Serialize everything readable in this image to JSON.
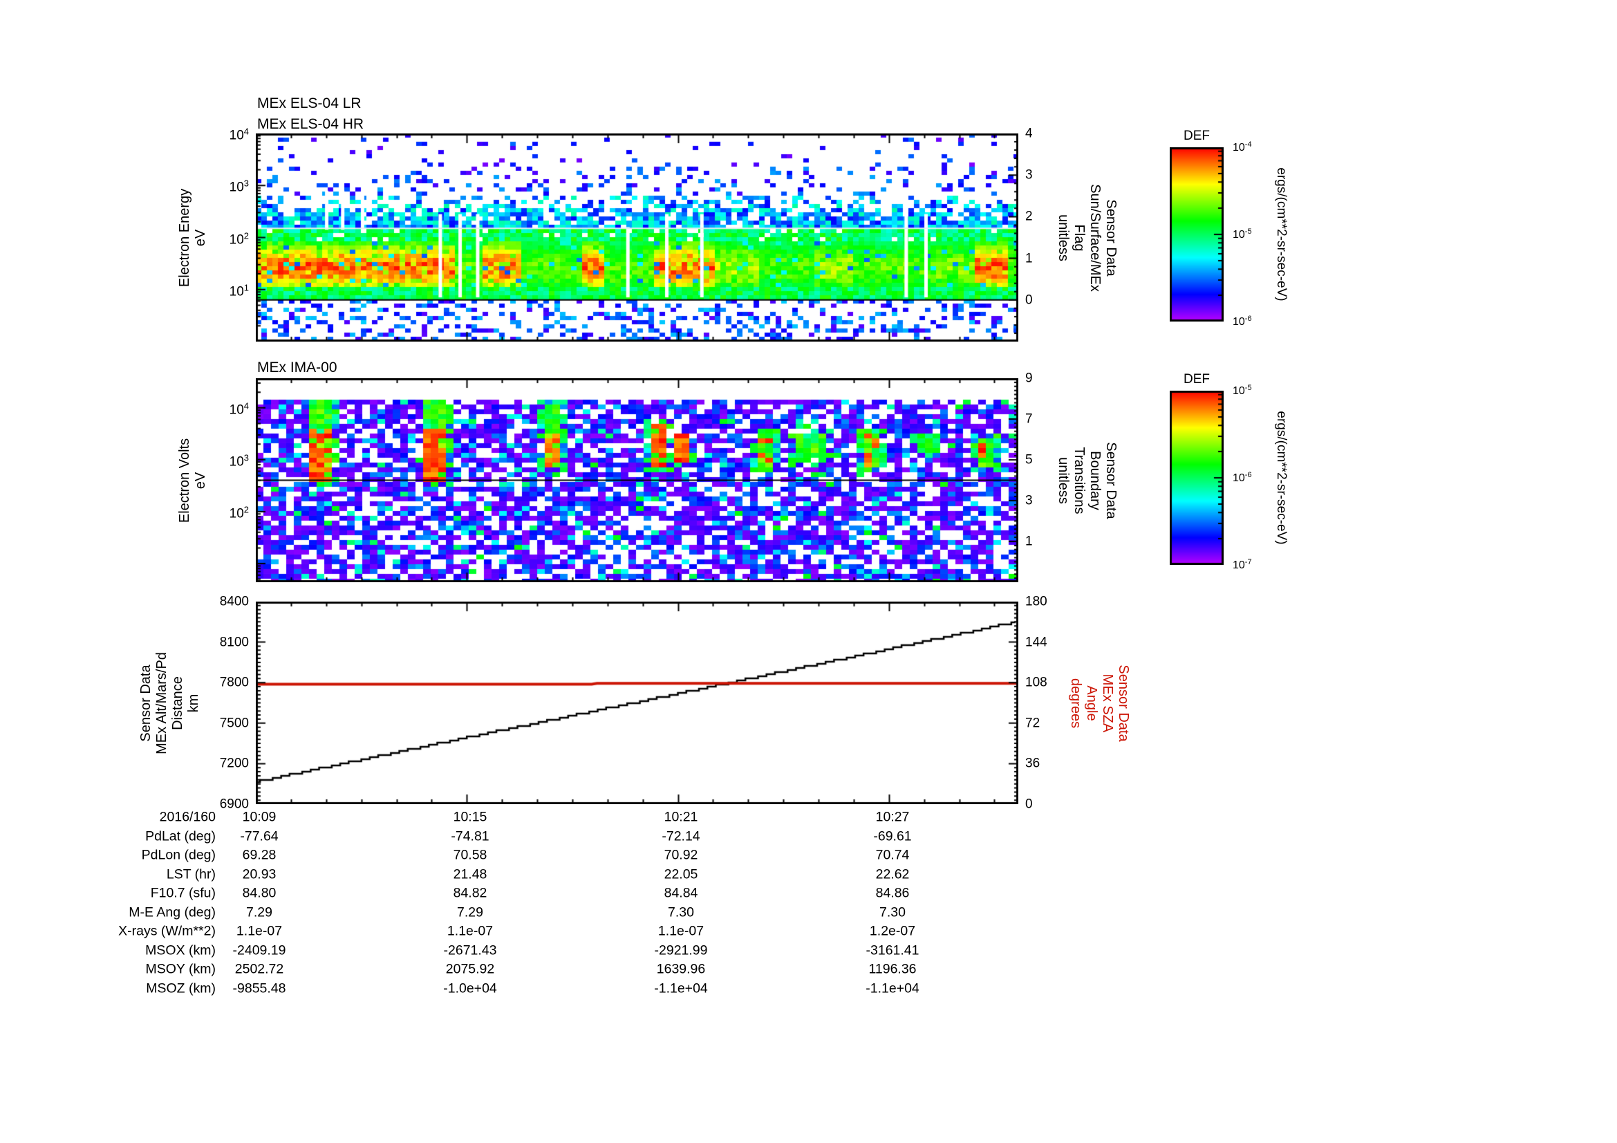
{
  "figure": {
    "background": "#ffffff",
    "accent_red": "#cc1505",
    "date_label": "2016/160"
  },
  "chart_data": [
    {
      "type": "heatmap",
      "name": "els-spectrogram",
      "titles": [
        "MEx ELS-04 LR",
        "MEx ELS-04 HR"
      ],
      "left_label": [
        "Electron Energy",
        "eV"
      ],
      "right_label": [
        "Sensor Data",
        "Sun/Surface/MEx",
        "Flag",
        "unitless"
      ],
      "y_axis": {
        "scale": "log",
        "min_exp": 0,
        "max_exp": 4,
        "tick_labels": [
          {
            "mant": "10",
            "exp": "4"
          },
          {
            "mant": "10",
            "exp": "3"
          },
          {
            "mant": "10",
            "exp": "2"
          },
          {
            "mant": "10",
            "exp": "1"
          }
        ],
        "tick_exps": [
          4,
          3,
          2,
          1
        ]
      },
      "right_axis": {
        "min": -1,
        "max": 4,
        "major_ticks": [
          4,
          3,
          2,
          1,
          0
        ],
        "minor_step": 0.2
      },
      "overlays": [
        {
          "desc": "flag=0 line",
          "value": 0,
          "color": "#000000",
          "width": 2
        },
        {
          "desc": "flag line",
          "value": 1.72,
          "color": "#e6eef0",
          "width": 2
        }
      ],
      "colorbar": {
        "title": "DEF",
        "tick_labels": [
          {
            "mant": "10",
            "exp": "-4"
          },
          {
            "mant": "10",
            "exp": "-5"
          },
          {
            "mant": "10",
            "exp": "-6"
          }
        ],
        "units": "ergs/(cm**2-sr-sec-eV)",
        "min_exp": -6,
        "max_exp": -4
      },
      "noise_seed": 1234567,
      "band_segments": [
        [
          0.0,
          0.165,
          1.0
        ],
        [
          0.165,
          0.175,
          0.9
        ],
        [
          0.175,
          0.26,
          0.97
        ],
        [
          0.26,
          0.3,
          0.62
        ],
        [
          0.3,
          0.35,
          0.88
        ],
        [
          0.35,
          0.43,
          0.58
        ],
        [
          0.43,
          0.46,
          0.82
        ],
        [
          0.46,
          0.52,
          0.62
        ],
        [
          0.52,
          0.565,
          0.8
        ],
        [
          0.565,
          0.6,
          0.9
        ],
        [
          0.6,
          0.66,
          0.72
        ],
        [
          0.66,
          0.73,
          0.55
        ],
        [
          0.73,
          0.78,
          0.72
        ],
        [
          0.78,
          0.89,
          0.58
        ],
        [
          0.89,
          0.94,
          0.65
        ],
        [
          0.94,
          0.99,
          0.85
        ],
        [
          0.99,
          1.0,
          0.6
        ]
      ],
      "data_gaps": [
        {
          "x": 0.093,
          "e0": 2.15,
          "e1": 2.9
        },
        {
          "x": 0.114,
          "e0": 2.15,
          "e1": 2.9
        },
        {
          "x": 0.14,
          "e0": 2.15,
          "e1": 2.9
        },
        {
          "x": 0.242,
          "e0": 0.85,
          "e1": 2.45
        },
        {
          "x": 0.268,
          "e0": 0.85,
          "e1": 2.45
        },
        {
          "x": 0.291,
          "e0": 0.85,
          "e1": 2.45
        },
        {
          "x": 0.488,
          "e0": 0.85,
          "e1": 2.2
        },
        {
          "x": 0.539,
          "e0": 0.85,
          "e1": 2.45
        },
        {
          "x": 0.585,
          "e0": 0.85,
          "e1": 2.45
        },
        {
          "x": 0.853,
          "e0": 0.85,
          "e1": 2.45
        },
        {
          "x": 0.879,
          "e0": 0.85,
          "e1": 2.45
        }
      ]
    },
    {
      "type": "heatmap",
      "name": "ima-spectrogram",
      "titles": [
        "MEx IMA-00"
      ],
      "left_label": [
        "Electron Volts",
        "eV"
      ],
      "right_label": [
        "Sensor Data",
        "Boundary",
        "Transitions",
        "unitless"
      ],
      "y_axis": {
        "scale": "log",
        "min_exp": 0.64,
        "max_exp": 4.57,
        "tick_labels": [
          {
            "mant": "10",
            "exp": "4"
          },
          {
            "mant": "10",
            "exp": "3"
          },
          {
            "mant": "10",
            "exp": "2"
          }
        ],
        "tick_exps": [
          4,
          3,
          2
        ]
      },
      "right_axis": {
        "min": -1,
        "max": 9,
        "major_ticks": [
          9,
          7,
          5,
          3,
          1
        ],
        "minor_step": 0.2
      },
      "overlays": [
        {
          "desc": "boundary transitions = 4",
          "value": 4,
          "color": "#000000",
          "width": 2
        }
      ],
      "colorbar": {
        "title": "DEF",
        "tick_labels": [
          {
            "mant": "10",
            "exp": "-5"
          },
          {
            "mant": "10",
            "exp": "-6"
          },
          {
            "mant": "10",
            "exp": "-7"
          }
        ],
        "units": "ergs/(cm**2-sr-sec-eV)",
        "min_exp": -7,
        "max_exp": -5
      },
      "noise_seed": 987654,
      "top_white_frac": 0.105,
      "ion_beams": [
        {
          "x": 0.085,
          "y0": 0.25,
          "y1": 0.5,
          "kind": "red"
        },
        {
          "x": 0.085,
          "y0": 0.11,
          "y1": 0.25,
          "kind": "green"
        },
        {
          "x": 0.235,
          "y0": 0.22,
          "y1": 0.5,
          "kind": "red"
        },
        {
          "x": 0.235,
          "y0": 0.11,
          "y1": 0.22,
          "kind": "green"
        },
        {
          "x": 0.385,
          "y0": 0.27,
          "y1": 0.44,
          "kind": "red"
        },
        {
          "x": 0.385,
          "y0": 0.14,
          "y1": 0.27,
          "kind": "green"
        },
        {
          "x": 0.53,
          "y0": 0.23,
          "y1": 0.44,
          "kind": "red"
        },
        {
          "x": 0.557,
          "y0": 0.26,
          "y1": 0.42,
          "kind": "red"
        },
        {
          "x": 0.665,
          "y0": 0.27,
          "y1": 0.43,
          "kind": "mixed"
        },
        {
          "x": 0.715,
          "y0": 0.26,
          "y1": 0.4,
          "kind": "green"
        },
        {
          "x": 0.74,
          "y0": 0.27,
          "y1": 0.38,
          "kind": "green"
        },
        {
          "x": 0.81,
          "y0": 0.28,
          "y1": 0.44,
          "kind": "mixed"
        },
        {
          "x": 0.875,
          "y0": 0.3,
          "y1": 0.37,
          "kind": "green"
        },
        {
          "x": 0.955,
          "y0": 0.3,
          "y1": 0.44,
          "kind": "mixed"
        }
      ]
    },
    {
      "type": "line",
      "name": "altitude-sza-plot",
      "left_label": [
        "Sensor Data",
        "MEx Alt/Mars/Pd",
        "Distance",
        "km"
      ],
      "right_label": [
        "Sensor Data",
        "MEx SZA",
        "Angle",
        "degrees"
      ],
      "y_axis": {
        "scale": "linear",
        "min": 6900,
        "max": 8400,
        "major_step": 300,
        "minor_step": 30,
        "tick_labels": [
          "8400",
          "8100",
          "7800",
          "7500",
          "7200",
          "6900"
        ]
      },
      "right_axis": {
        "min": 0,
        "max": 180,
        "major_step": 36,
        "minor_step": 3.6,
        "tick_labels": [
          "180",
          "144",
          "108",
          "72",
          "36",
          "0"
        ]
      },
      "series": [
        {
          "name": "MEx Alt/Mars/Pd Distance (km)",
          "color": "#000000",
          "axis": "left",
          "style": "stepped",
          "points_min_val": [
            [
              0,
              7065
            ],
            [
              6,
              7395
            ],
            [
              12,
              7720
            ],
            [
              18,
              8050
            ],
            [
              21.68,
              8255
            ]
          ]
        },
        {
          "name": "MEx SZA Angle (deg)",
          "color": "#cc1505",
          "axis": "right",
          "style": "plain",
          "points_min_val": [
            [
              0,
              106.6
            ],
            [
              9.55,
              106.6
            ],
            [
              9.7,
              107.4
            ],
            [
              21.68,
              107.4
            ]
          ]
        }
      ]
    },
    {
      "type": "table",
      "name": "ephemeris-table",
      "rows": [
        {
          "label": "2016/160",
          "values": [
            "10:09",
            "10:15",
            "10:21",
            "10:27"
          ]
        },
        {
          "label": "PdLat (deg)",
          "values": [
            "-77.64",
            "-74.81",
            "-72.14",
            "-69.61"
          ]
        },
        {
          "label": "PdLon (deg)",
          "values": [
            "69.28",
            "70.58",
            "70.92",
            "70.74"
          ]
        },
        {
          "label": "LST (hr)",
          "values": [
            "20.93",
            "21.48",
            "22.05",
            "22.62"
          ]
        },
        {
          "label": "F10.7 (sfu)",
          "values": [
            "84.80",
            "84.82",
            "84.84",
            "84.86"
          ]
        },
        {
          "label": "M-E Ang (deg)",
          "values": [
            "7.29",
            "7.29",
            "7.30",
            "7.30"
          ]
        },
        {
          "label": "X-rays (W/m**2)",
          "values": [
            "1.1e-07",
            "1.1e-07",
            "1.1e-07",
            "1.2e-07"
          ]
        },
        {
          "label": "MSOX (km)",
          "values": [
            "-2409.19",
            "-2671.43",
            "-2921.99",
            "-3161.41"
          ]
        },
        {
          "label": "MSOY (km)",
          "values": [
            "2502.72",
            "2075.92",
            "1639.96",
            "1196.36"
          ]
        },
        {
          "label": "MSOZ (km)",
          "values": [
            "-9855.48",
            "-1.0e+04",
            "-1.1e+04",
            "-1.1e+04"
          ]
        }
      ]
    }
  ],
  "time_axis": {
    "start": "10:09",
    "total_minutes": 21.68,
    "minor_tick_minutes": 1,
    "major_tick_minutes": 6,
    "major_labels": [
      "10:09",
      "10:15",
      "10:21",
      "10:27"
    ]
  }
}
